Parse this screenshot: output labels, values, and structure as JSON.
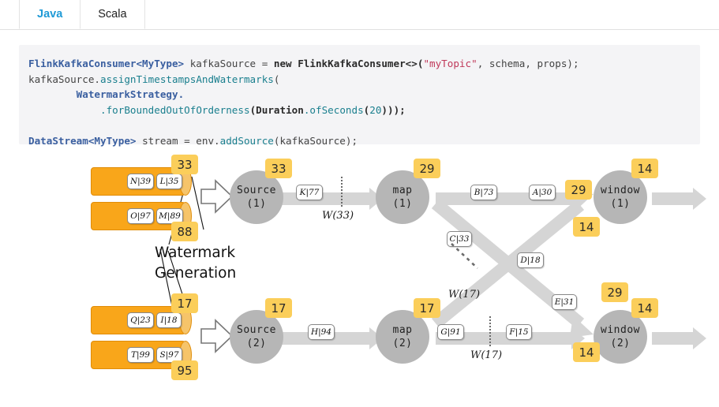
{
  "tabs": [
    {
      "label": "Java",
      "active": true
    },
    {
      "label": "Scala",
      "active": false
    }
  ],
  "code": {
    "line1_a": "FlinkKafkaConsumer<MyType>",
    "line1_b": " kafkaSource = ",
    "line1_c": "new FlinkKafkaConsumer<>(",
    "line1_d": "\"myTopic\"",
    "line1_e": ", schema, props);",
    "line2_a": "kafkaSource.",
    "line2_b": "assignTimestampsAndWatermarks",
    "line2_c": "(",
    "line3": "WatermarkStrategy.",
    "line4_a": ".forBoundedOutOfOrderness",
    "line4_b": "(",
    "line4_c": "Duration",
    "line4_d": ".ofSeconds",
    "line4_e": "(",
    "line4_f": "20",
    "line4_g": ")));",
    "line6_a": "DataStream<MyType>",
    "line6_b": " stream = env.",
    "line6_c": "addSource",
    "line6_d": "(kafkaSource);"
  },
  "diagram": {
    "watermark_generation_line1": "Watermark",
    "watermark_generation_line2": "Generation",
    "buffers": [
      {
        "name": "top-buffer-1",
        "records": [
          "N|39",
          "L|35"
        ],
        "badge": "33",
        "badge_pos": "top"
      },
      {
        "name": "top-buffer-2",
        "records": [
          "O|97",
          "M|89"
        ],
        "badge": "88",
        "badge_pos": "bottom"
      },
      {
        "name": "bottom-buffer-1",
        "records": [
          "Q|23",
          "I|18"
        ],
        "badge": "17",
        "badge_pos": "top"
      },
      {
        "name": "bottom-buffer-2",
        "records": [
          "T|99",
          "S|97"
        ],
        "badge": "95",
        "badge_pos": "bottom"
      }
    ],
    "nodes": [
      {
        "name": "source-1",
        "l1": "Source",
        "l2": "(1)",
        "badge": "33"
      },
      {
        "name": "map-1",
        "l1": "map",
        "l2": "(1)",
        "badge": "29"
      },
      {
        "name": "window-1",
        "l1": "window",
        "l2": "(1)",
        "badge": "14"
      },
      {
        "name": "source-2",
        "l1": "Source",
        "l2": "(2)",
        "badge": "17"
      },
      {
        "name": "map-2",
        "l1": "map",
        "l2": "(2)",
        "badge": "17"
      },
      {
        "name": "window-2",
        "l1": "window",
        "l2": "(2)",
        "badge": "14"
      }
    ],
    "stream_records": {
      "src1_to_map1": "K|77",
      "map1_to_win1_a": "B|73",
      "map1_to_win1_b": "A|30",
      "cross_upper": "C|33",
      "cross_mid": "D|18",
      "cross_lower": "E|31",
      "src2_to_map2": "H|94",
      "map2_to_win2_a": "G|91",
      "map2_to_win2_b": "F|15"
    },
    "watermarks": {
      "w33": "W(33)",
      "w17_cross": "W(17)",
      "w17_bottom": "W(17)"
    },
    "edge_badges": {
      "map1_out": "29",
      "map1_cross": "14",
      "map2_cross": "14",
      "map2_out": "29",
      "win1_in_low": "14",
      "win2_in_low": "14"
    },
    "colors": {
      "badge": "#fbce5a",
      "node": "#b6b6b6",
      "stream": "#d5d5d5",
      "buffer": "#f9a61a",
      "accent": "#1f9ad6"
    }
  }
}
